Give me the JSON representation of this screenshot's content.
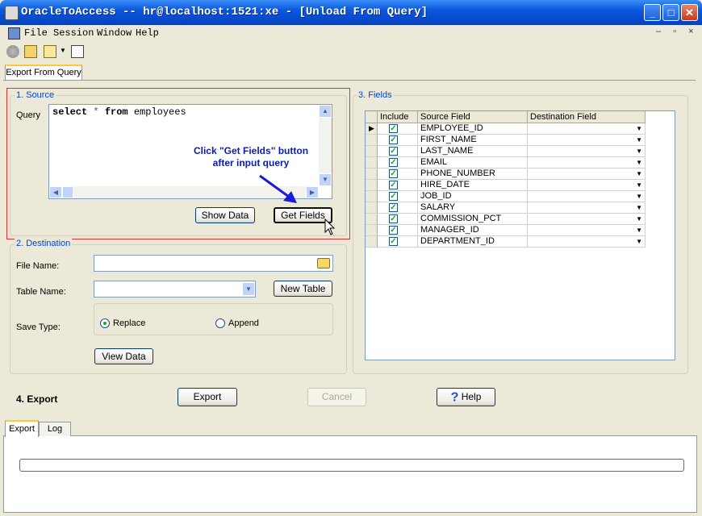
{
  "window": {
    "title": "OracleToAccess -- hr@localhost:1521:xe - [Unload From Query]",
    "minimize": "_",
    "maximize": "□",
    "close": "✕"
  },
  "menu": [
    "File",
    "Session",
    "Window",
    "Help"
  ],
  "mdi_controls": "–  ▫  ×",
  "tabs": [
    "Export From Query"
  ],
  "source": {
    "title": "1. Source",
    "query_label": "Query",
    "query_keywords": [
      "select",
      "*",
      "from"
    ],
    "query_table": "employees",
    "hint_line1": "Click \"Get Fields\" button",
    "hint_line2": "after input query",
    "show_data": "Show Data",
    "get_fields": "Get Fields"
  },
  "destination": {
    "title": "2. Destination",
    "file_name_label": "File Name:",
    "file_name_value": "",
    "table_name_label": "Table Name:",
    "table_name_value": "",
    "new_table": "New Table",
    "save_type_label": "Save Type:",
    "replace": "Replace",
    "append": "Append",
    "view_data": "View Data"
  },
  "fields": {
    "title": "3. Fields",
    "columns": [
      "Include",
      "Source Field",
      "Destination Field"
    ],
    "rows": [
      "EMPLOYEE_ID",
      "FIRST_NAME",
      "LAST_NAME",
      "EMAIL",
      "PHONE_NUMBER",
      "HIRE_DATE",
      "JOB_ID",
      "SALARY",
      "COMMISSION_PCT",
      "MANAGER_ID",
      "DEPARTMENT_ID"
    ]
  },
  "export": {
    "title": "4. Export",
    "export_btn": "Export",
    "cancel_btn": "Cancel",
    "help_btn": "Help"
  },
  "bottom_tabs": [
    "Export",
    "Log"
  ],
  "colors": {
    "accent": "#0046d5",
    "titlebar": "#0a58e0",
    "highlight_border": "#e03030",
    "arrow": "#1a1adc"
  }
}
